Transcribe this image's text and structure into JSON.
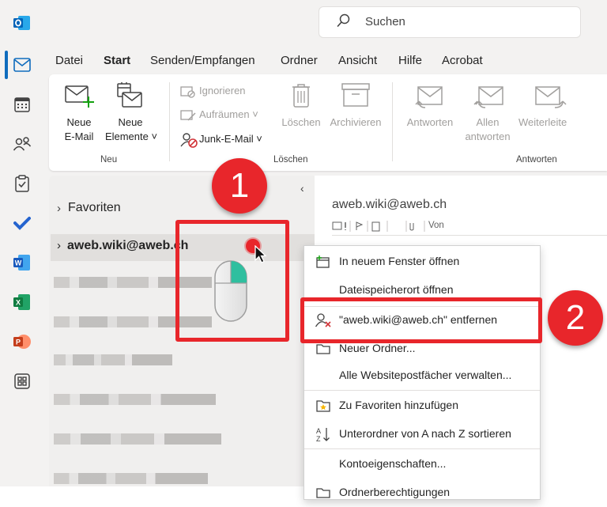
{
  "app": {
    "name": "Outlook"
  },
  "colors": {
    "accent": "#0f6cbd",
    "annotation_red": "#e8262b"
  },
  "rail": {
    "items": [
      {
        "icon": "outlook-logo-icon"
      },
      {
        "icon": "mail-icon",
        "selected": true
      },
      {
        "icon": "calendar-icon"
      },
      {
        "icon": "people-icon"
      },
      {
        "icon": "tasks-icon"
      },
      {
        "icon": "todo-icon"
      },
      {
        "icon": "word-icon"
      },
      {
        "icon": "excel-icon"
      },
      {
        "icon": "powerpoint-icon"
      },
      {
        "icon": "apps-icon"
      }
    ]
  },
  "search": {
    "placeholder": "Suchen"
  },
  "menu": {
    "tabs": [
      "Datei",
      "Start",
      "Senden/Empfangen",
      "Ordner",
      "Ansicht",
      "Hilfe",
      "Acrobat"
    ],
    "active": "Start"
  },
  "ribbon": {
    "new_email": [
      "Neue",
      "E-Mail"
    ],
    "new_items": [
      "Neue",
      "Elemente ˅"
    ],
    "ignore": "Ignorieren",
    "cleanup": "Aufräumen ˅",
    "junk": "Junk-E-Mail ˅",
    "delete": "Löschen",
    "archive": "Archivieren",
    "reply": "Antworten",
    "reply_all": [
      "Allen",
      "antworten"
    ],
    "forward": "Weiterleite",
    "groups": {
      "new": "Neu",
      "delete": "Löschen",
      "respond": "Antworten"
    }
  },
  "folder_pane": {
    "collapse_glyph": "‹",
    "favorites": "Favoriten",
    "account": "aweb.wiki@aweb.ch"
  },
  "message_list": {
    "account_header": "aweb.wiki@aweb.ch",
    "column_from": "Von"
  },
  "context_menu": {
    "items": [
      {
        "label": "In neuem Fenster öffnen",
        "icon": "new-window-icon"
      },
      {
        "label": "Dateispeicherort öffnen",
        "icon": ""
      },
      {
        "label": "\"aweb.wiki@aweb.ch\" entfernen",
        "icon": "remove-account-icon"
      },
      {
        "label": "Neuer Ordner...",
        "icon": "folder-icon"
      },
      {
        "label": "Alle Websitepostfächer verwalten...",
        "icon": ""
      },
      {
        "label": "Zu Favoriten hinzufügen",
        "icon": "favorite-folder-icon"
      },
      {
        "label": "Unterordner von A nach Z sortieren",
        "icon": "sort-az-icon"
      },
      {
        "label": "Kontoeigenschaften...",
        "icon": ""
      },
      {
        "label": "Ordnerberechtigungen",
        "icon": "permissions-icon"
      }
    ]
  },
  "annotations": {
    "step1": "1",
    "step2": "2"
  }
}
